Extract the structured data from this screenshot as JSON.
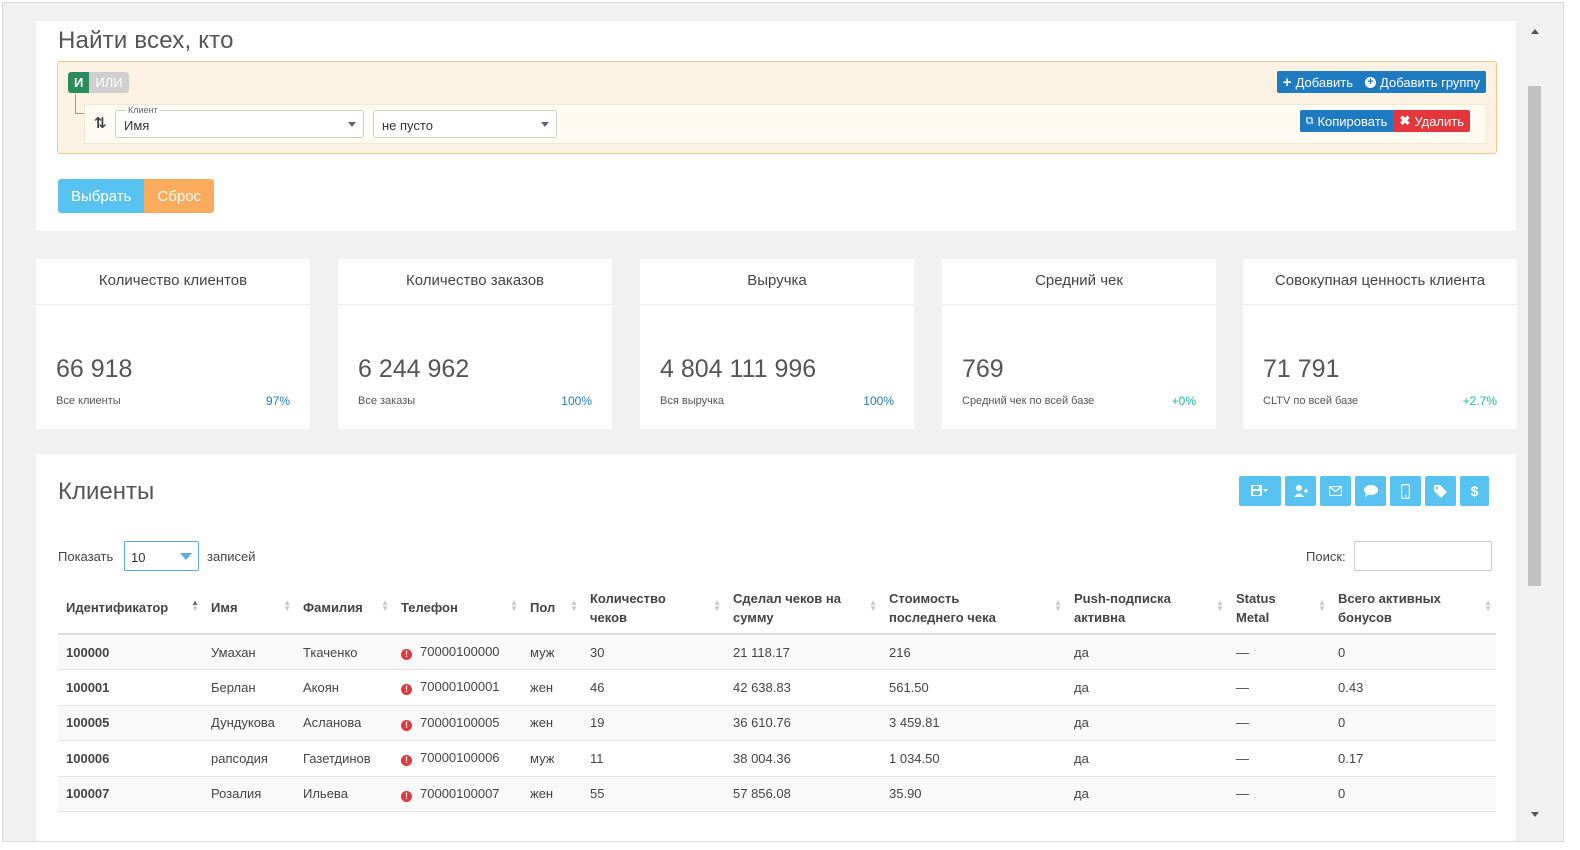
{
  "filter": {
    "title": "Найти всех, кто",
    "logic_and": "И",
    "logic_or": "ИЛИ",
    "add_label": "Добавить",
    "add_group_label": "Добавить группу",
    "rule": {
      "field_label": "Клиент",
      "field_value": "Имя",
      "operator_value": "не пусто",
      "copy_label": "Копировать",
      "delete_label": "Удалить"
    },
    "select_label": "Выбрать",
    "reset_label": "Сброс"
  },
  "stats": [
    {
      "title": "Количество клиентов",
      "value": "66 918",
      "subtitle": "Все клиенты",
      "percent": "97%",
      "percent_color": "#1f7bc1"
    },
    {
      "title": "Количество заказов",
      "value": "6 244 962",
      "subtitle": "Все заказы",
      "percent": "100%",
      "percent_color": "#1f7bc1"
    },
    {
      "title": "Выручка",
      "value": "4 804 111 996",
      "subtitle": "Вся выручка",
      "percent": "100%",
      "percent_color": "#1f7bc1"
    },
    {
      "title": "Средний чек",
      "value": "769",
      "subtitle": "Средний чек по всей базе",
      "percent": "+0%",
      "percent_color": "#19b9a6"
    },
    {
      "title": "Совокупная ценность клиента",
      "value": "71 791",
      "subtitle": "CLTV по всей базе",
      "percent": "+2.7%",
      "percent_color": "#19b9a6"
    }
  ],
  "clients": {
    "title": "Клиенты",
    "toolbar_icons": [
      "save-dropdown-icon",
      "add-user-icon",
      "envelope-icon",
      "chat-icon",
      "mobile-icon",
      "tag-icon",
      "dollar-icon"
    ],
    "show_label": "Показать",
    "page_length": "10",
    "records_label": "записей",
    "search_label": "Поиск:",
    "search_value": "",
    "columns": [
      "Идентификатор",
      "Имя",
      "Фамилия",
      "Телефон",
      "Пол",
      "Количество чеков",
      "Сделал чеков на сумму",
      "Стоимость последнего чека",
      "Push-подписка активна",
      "Status Metal",
      "Всего активных бонусов"
    ],
    "rows": [
      [
        "100000",
        "Умахан",
        "Ткаченко",
        "70000100000",
        "муж",
        "30",
        "21 118.17",
        "216",
        "да",
        "—",
        "0"
      ],
      [
        "100001",
        "Берлан",
        "Акоян",
        "70000100001",
        "жен",
        "46",
        "42 638.83",
        "561.50",
        "да",
        "—",
        "0.43"
      ],
      [
        "100005",
        "Дундукова",
        "Асланова",
        "70000100005",
        "жен",
        "19",
        "36 610.76",
        "3 459.81",
        "да",
        "—",
        "0"
      ],
      [
        "100006",
        "рапсодия",
        "Газетдинов",
        "70000100006",
        "муж",
        "11",
        "38 004.36",
        "1 034.50",
        "да",
        "—",
        "0.17"
      ],
      [
        "100007",
        "Розалия",
        "Ильева",
        "70000100007",
        "жен",
        "55",
        "57 856.08",
        "35.90",
        "да",
        "—",
        "0"
      ]
    ]
  }
}
